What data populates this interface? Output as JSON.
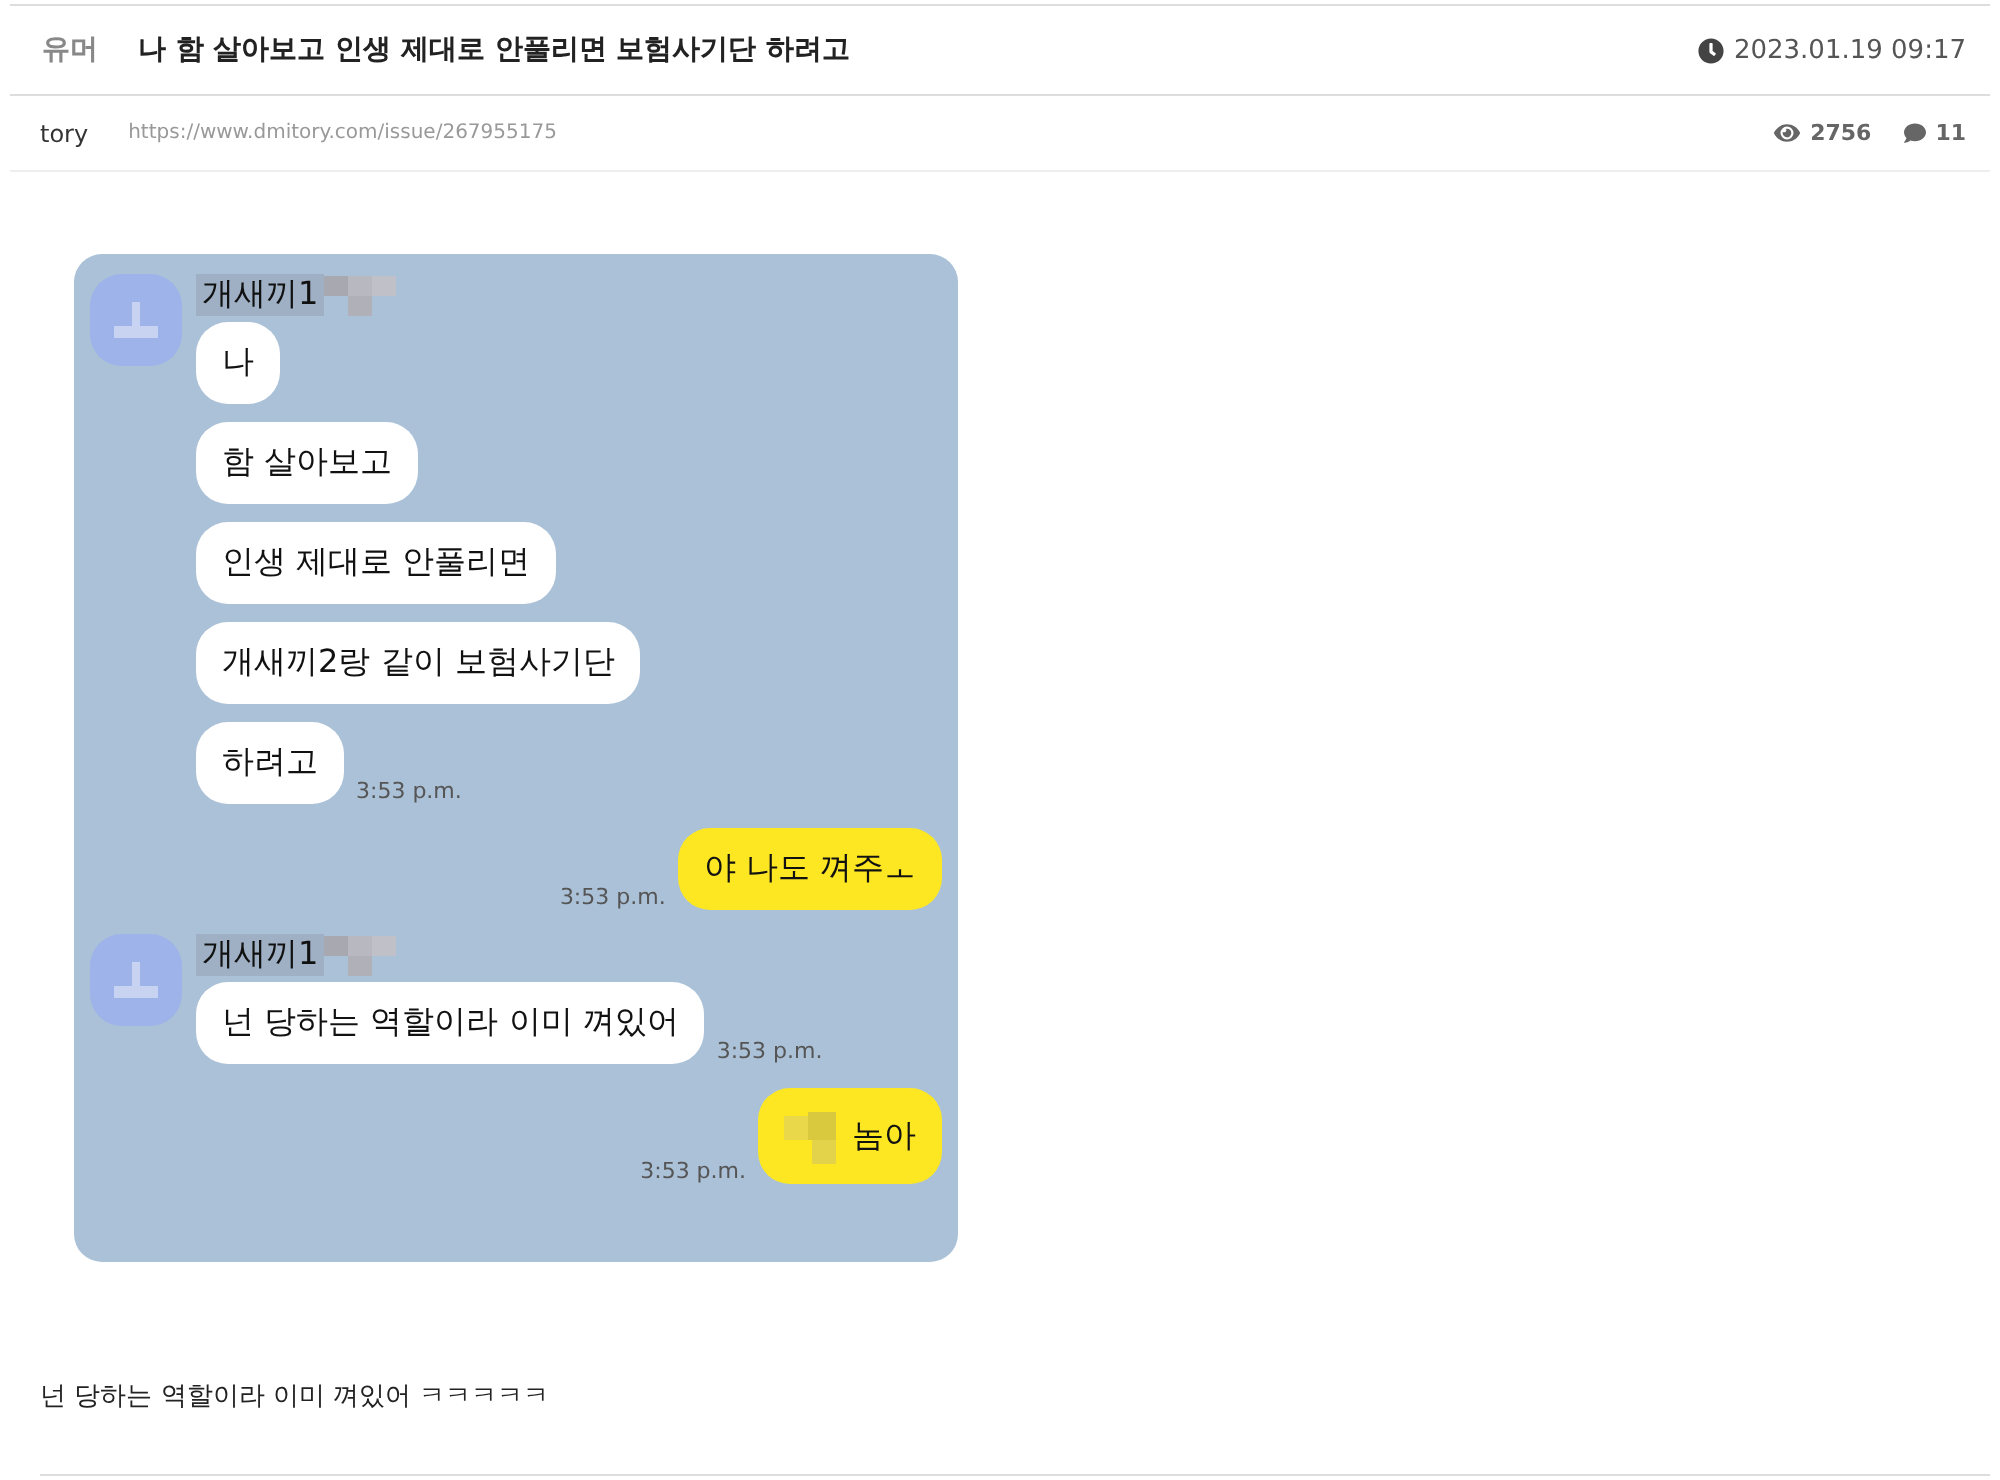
{
  "post": {
    "category": "유머",
    "title": "나 함 살아보고 인생 제대로 안풀리면 보험사기단 하려고",
    "date": "2023.01.19 09:17",
    "author": "tory",
    "url": "https://www.dmitory.com/issue/267955175",
    "views": "2756",
    "comments": "11"
  },
  "chat": [
    {
      "kind": "received",
      "sender": "개새끼1",
      "bubbles": [
        {
          "text": "나",
          "redacted": false
        },
        {
          "text": "함 살아보고",
          "redacted": false
        },
        {
          "text": "인생 제대로 안풀리면",
          "redacted": false
        },
        {
          "text": "개새끼2랑 같이 보험사기단",
          "redacted": false
        },
        {
          "text": "하려고",
          "redacted": false
        }
      ],
      "time": "3:53 p.m."
    },
    {
      "kind": "sent",
      "bubbles": [
        {
          "text": "야 나도 껴주ㅗ",
          "redacted": false
        }
      ],
      "time": "3:53 p.m."
    },
    {
      "kind": "received",
      "sender": "개새끼1",
      "bubbles": [
        {
          "text": "넌 당하는 역할이라 이미 껴있어",
          "redacted": false
        }
      ],
      "time": "3:53 p.m."
    },
    {
      "kind": "sent",
      "bubbles": [
        {
          "text": "놈아",
          "redacted": true
        }
      ],
      "time": "3:53 p.m."
    }
  ],
  "body": "넌 당하는 역할이라 이미 껴있어 ㅋㅋㅋㅋㅋ"
}
